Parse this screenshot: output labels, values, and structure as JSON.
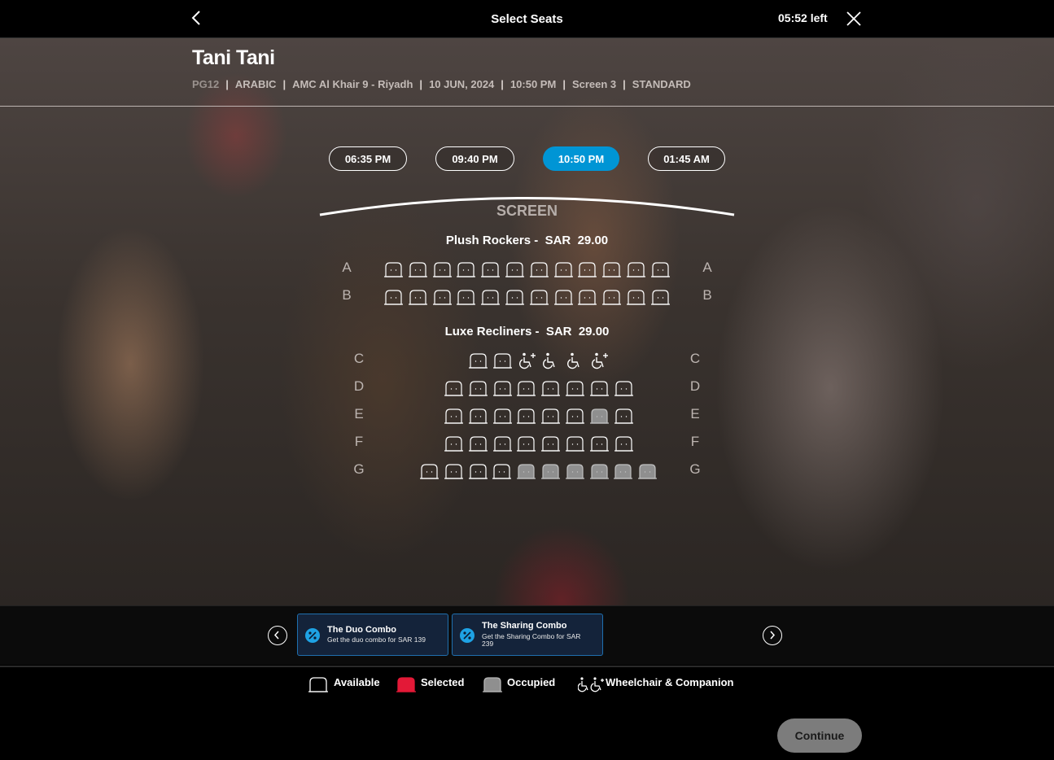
{
  "header": {
    "title": "Select Seats",
    "timer": "05:52 left"
  },
  "movie": {
    "title": "Tani Tani",
    "rating": "PG12",
    "language": "ARABIC",
    "cinema": "AMC Al Khair 9 - Riyadh",
    "date": "10 JUN, 2024",
    "time": "10:50 PM",
    "screen": "Screen 3",
    "format": "STANDARD"
  },
  "showtimes": [
    {
      "label": "06:35 PM",
      "active": false
    },
    {
      "label": "09:40 PM",
      "active": false
    },
    {
      "label": "10:50 PM",
      "active": true
    },
    {
      "label": "01:45 AM",
      "active": false
    }
  ],
  "screen_label": "SCREEN",
  "sections": [
    {
      "name": "Plush Rockers -",
      "currency": "SAR",
      "price": "29.00"
    },
    {
      "name": "Luxe Recliners -",
      "currency": "SAR",
      "price": "29.00"
    }
  ],
  "rows": [
    {
      "label": "A",
      "seats": [
        "a",
        "a",
        "a",
        "a",
        "a",
        "a",
        "a",
        "a",
        "a",
        "a",
        "a",
        "a"
      ]
    },
    {
      "label": "B",
      "seats": [
        "a",
        "a",
        "a",
        "a",
        "a",
        "a",
        "a",
        "a",
        "a",
        "a",
        "a",
        "a"
      ]
    },
    {
      "label": "C",
      "seats": [
        "a",
        "a",
        "c",
        "w",
        "w",
        "c"
      ]
    },
    {
      "label": "D",
      "seats": [
        "a",
        "a",
        "a",
        "a",
        "a",
        "a",
        "a",
        "a"
      ]
    },
    {
      "label": "E",
      "seats": [
        "a",
        "a",
        "a",
        "a",
        "a",
        "a",
        "o",
        "a"
      ]
    },
    {
      "label": "F",
      "seats": [
        "a",
        "a",
        "a",
        "a",
        "a",
        "a",
        "a",
        "a"
      ]
    },
    {
      "label": "G",
      "seats": [
        "a",
        "a",
        "a",
        "a",
        "o",
        "o",
        "o",
        "o",
        "o",
        "o"
      ]
    }
  ],
  "combos": [
    {
      "title": "The Duo Combo",
      "desc": "Get the duo combo for SAR 139"
    },
    {
      "title": "The Sharing Combo",
      "desc": "Get the Sharing Combo for SAR 239"
    }
  ],
  "legend": {
    "available": "Available",
    "selected": "Selected",
    "occupied": "Occupied",
    "wheelchair": "Wheelchair & Companion"
  },
  "continue_label": "Continue",
  "colors": {
    "accent": "#0095d5",
    "selected": "#e31937",
    "occupied": "#8f8f8f",
    "combo_border": "#1f6fae"
  }
}
